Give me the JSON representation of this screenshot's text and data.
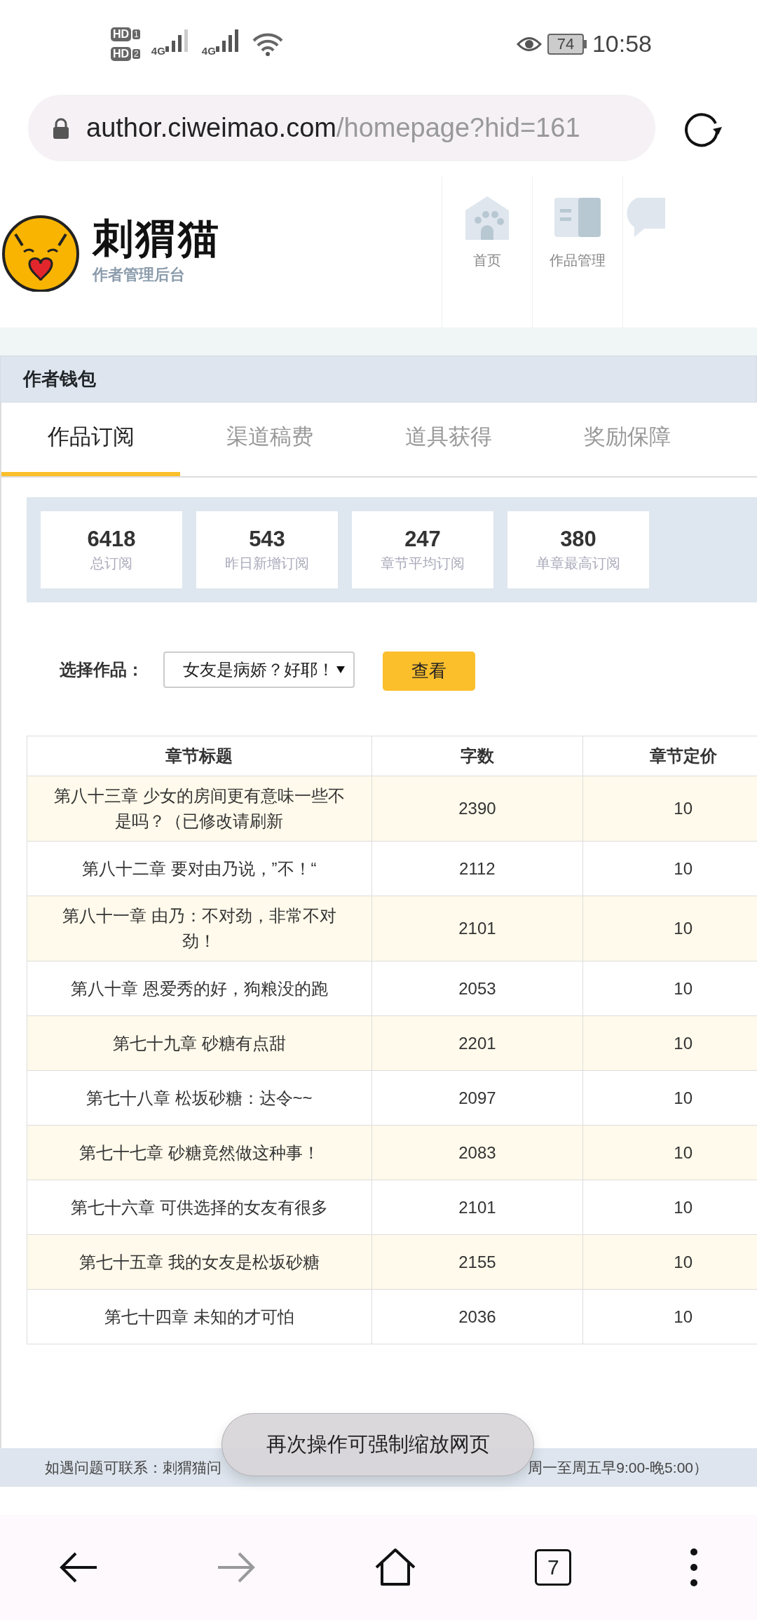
{
  "status_bar": {
    "sims": [
      {
        "badge": "HD",
        "slot": "1"
      },
      {
        "badge": "HD",
        "slot": "2"
      }
    ],
    "networks": [
      "4G",
      "4G"
    ],
    "battery": "74",
    "time": "10:58"
  },
  "browser": {
    "url_host": "author.ciweimao.com",
    "url_path": "/homepage?hid=161",
    "tab_count": "7"
  },
  "header": {
    "brand": "刺猬猫",
    "subtitle": "作者管理后台",
    "nav": [
      {
        "label": "首页",
        "kind": "home"
      },
      {
        "label": "作品管理",
        "kind": "book"
      },
      {
        "kind": "chat"
      }
    ]
  },
  "section_title": "作者钱包",
  "tabs": [
    {
      "label": "作品订阅",
      "selected": true
    },
    {
      "label": "渠道稿费",
      "selected": false
    },
    {
      "label": "道具获得",
      "selected": false
    },
    {
      "label": "奖励保障",
      "selected": false
    }
  ],
  "stats": [
    {
      "value": "6418",
      "label": "总订阅"
    },
    {
      "value": "543",
      "label": "昨日新增订阅"
    },
    {
      "value": "247",
      "label": "章节平均订阅"
    },
    {
      "value": "380",
      "label": "单章最高订阅"
    }
  ],
  "selector": {
    "label": "选择作品：",
    "value": "女友是病娇？好耶！",
    "button": "查看"
  },
  "table": {
    "columns": [
      "章节标题",
      "字数",
      "章节定价"
    ],
    "rows": [
      [
        "第八十三章 少女的房间更有意味一些不是吗？（已修改请刷新",
        "2390",
        "10"
      ],
      [
        "第八十二章 要对由乃说，”不！“",
        "2112",
        "10"
      ],
      [
        "第八十一章 由乃：不对劲，非常不对劲！",
        "2101",
        "10"
      ],
      [
        "第八十章 恩爱秀的好，狗粮没的跑",
        "2053",
        "10"
      ],
      [
        "第七十九章 砂糖有点甜",
        "2201",
        "10"
      ],
      [
        "第七十八章 松坂砂糖：达令~~",
        "2097",
        "10"
      ],
      [
        "第七十七章 砂糖竟然做这种事！",
        "2083",
        "10"
      ],
      [
        "第七十六章 可供选择的女友有很多",
        "2101",
        "10"
      ],
      [
        "第七十五章 我的女友是松坂砂糖",
        "2155",
        "10"
      ],
      [
        "第七十四章 未知的才可怕",
        "2036",
        "10"
      ]
    ]
  },
  "footer_parts": [
    "如遇问题可联系：刺猬猫问",
    "周一至周五早9:00-晚5:00）"
  ],
  "toast": "再次操作可强制缩放网页"
}
